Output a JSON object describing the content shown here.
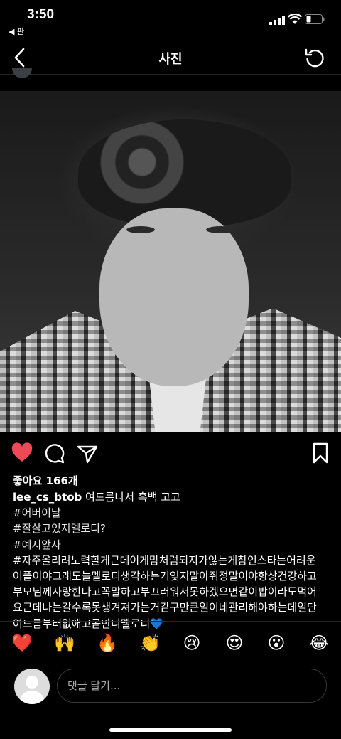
{
  "status": {
    "time": "3:50",
    "back_app": "◀ 판"
  },
  "nav": {
    "title": "사진"
  },
  "post": {
    "like_count_text": "좋아요 166개",
    "username": "lee_cs_btob",
    "caption_first": "여드름나서 흑백 고고",
    "hashtags": [
      "#어버이날",
      "#잘살고있지멜로디?",
      "#예지앞사"
    ],
    "long_lines": [
      "#자주올리려노력할게근데이게맘처럼되지가않는게참인스타는어려운",
      "어플이야그래도늘멜로디생각하는거잊지말아줘정말이야항상건강하고",
      "부모님께사랑한다고꼭말하고부끄러워서못하겠으면같이밥이라도먹어",
      "요근데나는갈수록못생겨져가는거같구만큰일이네관리해야하는데일단",
      "여드름부터없애고곧만니멜로디💙"
    ],
    "liked": true
  },
  "emoji_reactions": [
    "❤️",
    "🙌",
    "🔥",
    "👏",
    "😢",
    "😍",
    "😮",
    "😂"
  ],
  "comment": {
    "placeholder": "댓글 달기..."
  },
  "colors": {
    "like_red": "#ed4956",
    "background": "#000000",
    "divider": "#262626"
  }
}
